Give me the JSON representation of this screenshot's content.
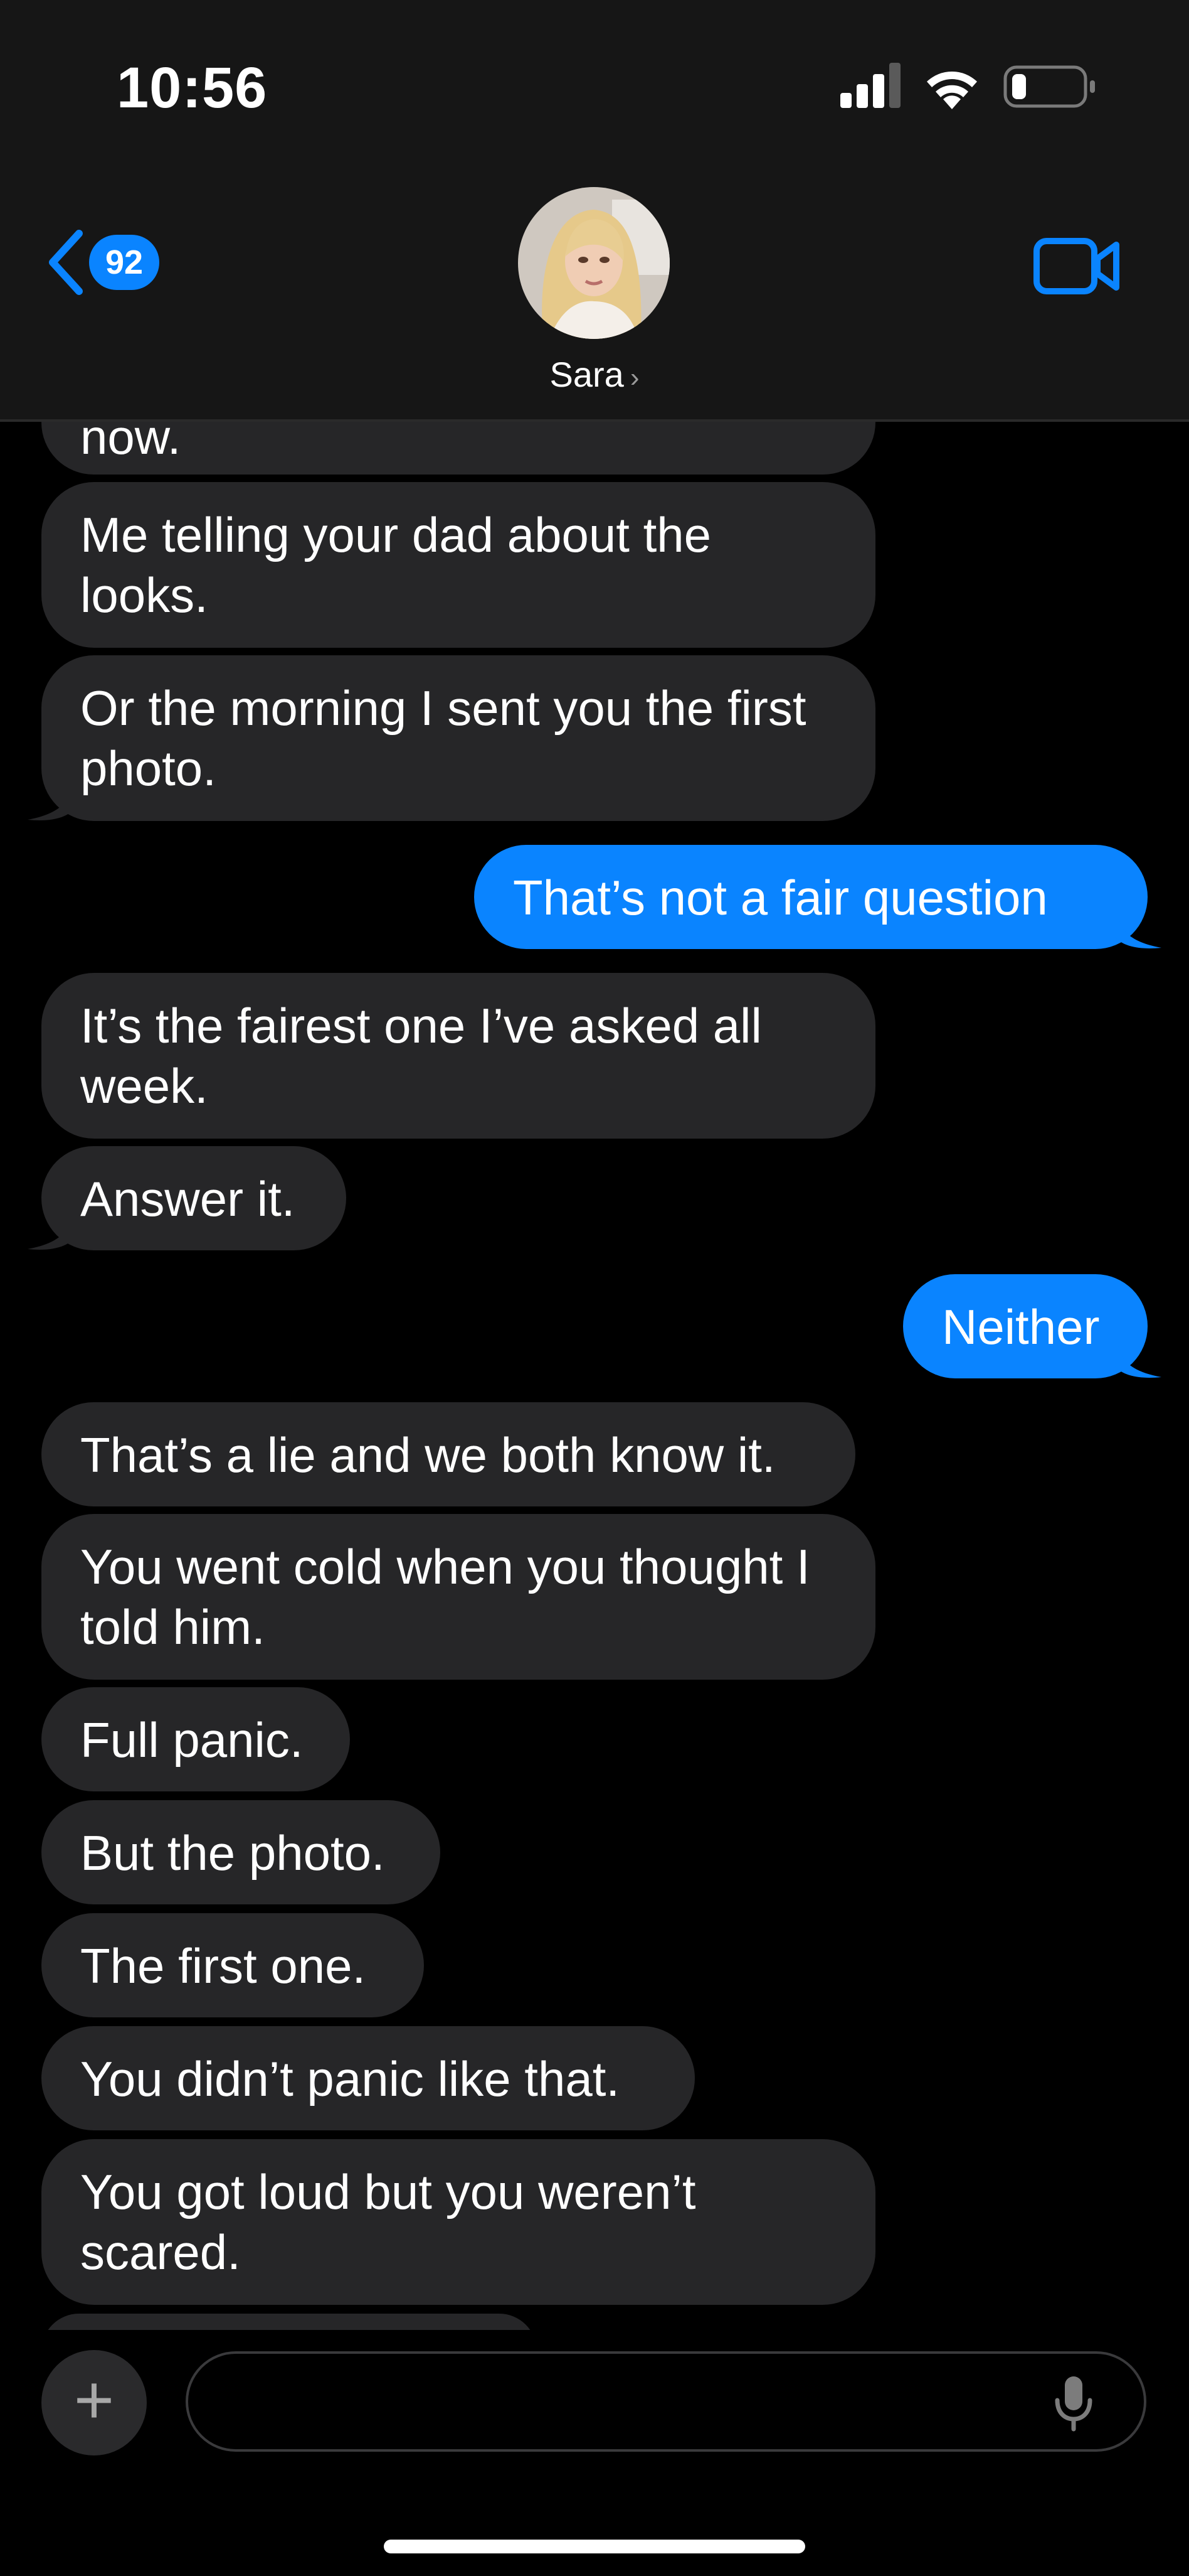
{
  "status_bar": {
    "time": "10:56"
  },
  "header": {
    "back_count": "92",
    "contact_name": "Sara",
    "contact_chevron": "›"
  },
  "messages": [
    {
      "from": "them",
      "text": "now."
    },
    {
      "from": "them",
      "text": "Me telling your dad about the looks."
    },
    {
      "from": "them",
      "text": "Or the morning I sent you the first photo."
    },
    {
      "from": "me",
      "text": "That’s not a fair question"
    },
    {
      "from": "them",
      "text": "It’s the fairest one I’ve asked all week."
    },
    {
      "from": "them",
      "text": "Answer it."
    },
    {
      "from": "me",
      "text": "Neither"
    },
    {
      "from": "them",
      "text": "That’s a lie and we both know it."
    },
    {
      "from": "them",
      "text": "You went cold when you thought I told him."
    },
    {
      "from": "them",
      "text": "Full panic."
    },
    {
      "from": "them",
      "text": "But the photo."
    },
    {
      "from": "them",
      "text": "The first one."
    },
    {
      "from": "them",
      "text": "You didn’t panic like that."
    },
    {
      "from": "them",
      "text": "You got loud but you weren’t scared."
    }
  ],
  "composer": {
    "placeholder": "",
    "plus_label": "+"
  },
  "icons": {
    "back": "chevron-left-icon",
    "video": "video-camera-icon",
    "mic": "microphone-icon",
    "signal": "cellular-signal-icon",
    "wifi": "wifi-icon",
    "battery": "battery-low-icon"
  },
  "colors": {
    "accent": "#0a84ff",
    "incoming_bubble": "#262628",
    "header_bg": "#161616"
  }
}
